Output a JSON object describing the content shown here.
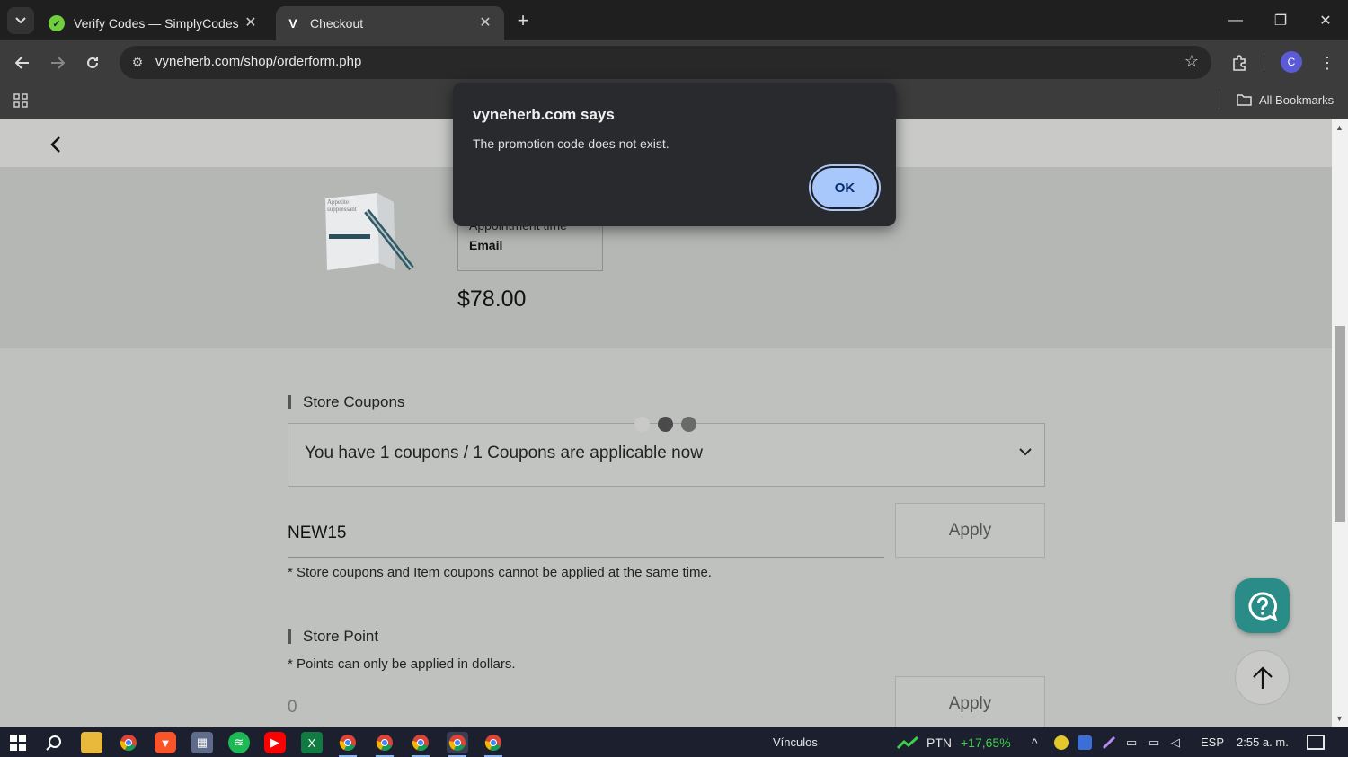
{
  "browser": {
    "tabs": [
      {
        "title": "Verify Codes — SimplyCodes",
        "favicon": "simplycodes-icon",
        "active": false
      },
      {
        "title": "Checkout",
        "favicon": "v-icon",
        "active": true
      }
    ],
    "url": "vyneherb.com/shop/orderform.php",
    "profile_initial": "C",
    "bookmarks_label": "All Bookmarks"
  },
  "dialog": {
    "title": "vyneherb.com says",
    "message": "The promotion code does not exist.",
    "ok_label": "OK"
  },
  "product": {
    "image_text": "Appetite suppressant",
    "option_label": "Appointment time",
    "option_value": "Email",
    "price": "$78.00"
  },
  "coupons": {
    "section_title": "Store Coupons",
    "select_text": "You have 1 coupons / 1 Coupons are applicable now",
    "input_value": "NEW15",
    "apply_label": "Apply",
    "note": "* Store coupons and Item coupons cannot be applied at the same time."
  },
  "points": {
    "section_title": "Store Point",
    "note": "* Points can only be applied in dollars.",
    "input_value": "0",
    "apply_label": "Apply"
  },
  "loading_dots": [
    "#c9cac8",
    "#4a4a4a",
    "#6a6a6a"
  ],
  "colors": {
    "accent": "#a8c7fa",
    "help_button": "#2a8c86"
  },
  "taskbar": {
    "links_label": "Vínculos",
    "stock_ticker": "PTN",
    "stock_change": "+17,65%",
    "language": "ESP",
    "time": "2:55 a. m."
  }
}
